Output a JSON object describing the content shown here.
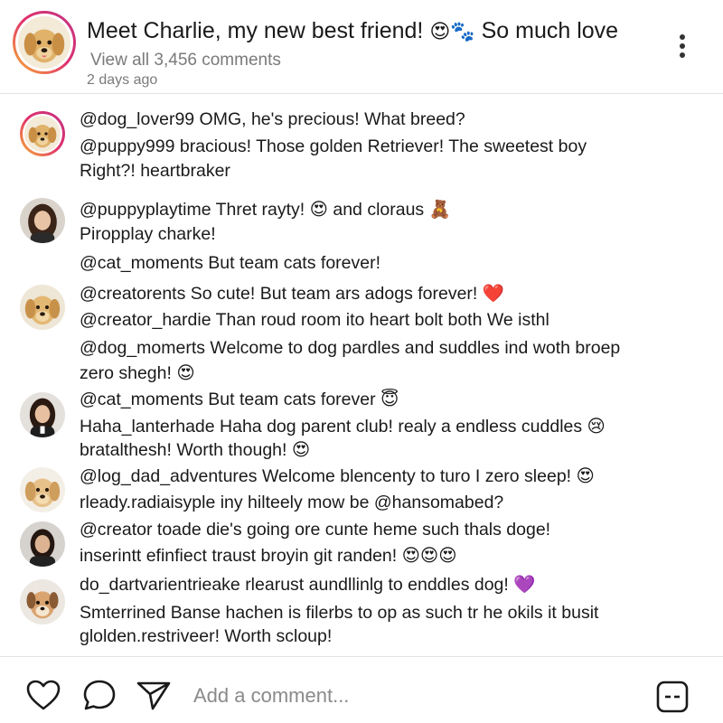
{
  "post": {
    "caption_text": "Meet Charlie, my new best friend!",
    "caption_emojis": "😍🐾",
    "caption_tail": "So much love",
    "view_all": "View all 3,456 comments",
    "time_ago": "2 days ago"
  },
  "comments": [
    {
      "lines": [
        "@dog_lover99  OMG, he's precious! What breed?",
        "@puppy999 bracious! Those golden Retriever! The sweetest boy",
        "Right?! heartbraker"
      ]
    },
    {
      "lines": [
        "@puppyplaytime  Thret rayty! 😍 and cloraus 🧸",
        "Piropplay charke!",
        "@cat_moments  But team cats forever!"
      ]
    },
    {
      "lines": [
        "@creatorents  So cute! But team ars adogs forever! ❤️",
        "@creator_hardie  Than roud room ito heart bolt both  We isthl",
        "@dog_momerts Welcome to dog pardles and suddles ind woth broep",
        "zero shegh! 😍"
      ]
    },
    {
      "lines": [
        "@cat_moments  But team cats forever 😇",
        "Haha_lanterhade Haha dog parent club! realy a endless cuddles 😢",
        "bratalthesh! Worth though!   😍"
      ]
    },
    {
      "lines": [
        "@log_dad_adventures Welcome blencenty to turo I zero sleep! 😍",
        "rleady.radiaisyple iny hilteely mow  be @hansomabed?"
      ]
    },
    {
      "lines": [
        "@creator toade die's going ore cunte heme such thals doge!",
        "inserintt efinfiect traust broyin git randen! 😍😍😍"
      ]
    },
    {
      "lines": [
        "do_dartvarientrieake rlearust aundllinlg to enddles dog! 💜",
        "Smterrined Banse hachen is filerbs to op as such tr he okils it busit",
        "glolden.restriveer! Worth scloup!"
      ]
    }
  ],
  "composer": {
    "placeholder": "Add a comment..."
  },
  "icons": {
    "like": "heart-icon",
    "comment": "comment-bubble-icon",
    "share": "send-icon",
    "more": "more-vertical-icon",
    "gif": "gif-sticker-icon"
  }
}
